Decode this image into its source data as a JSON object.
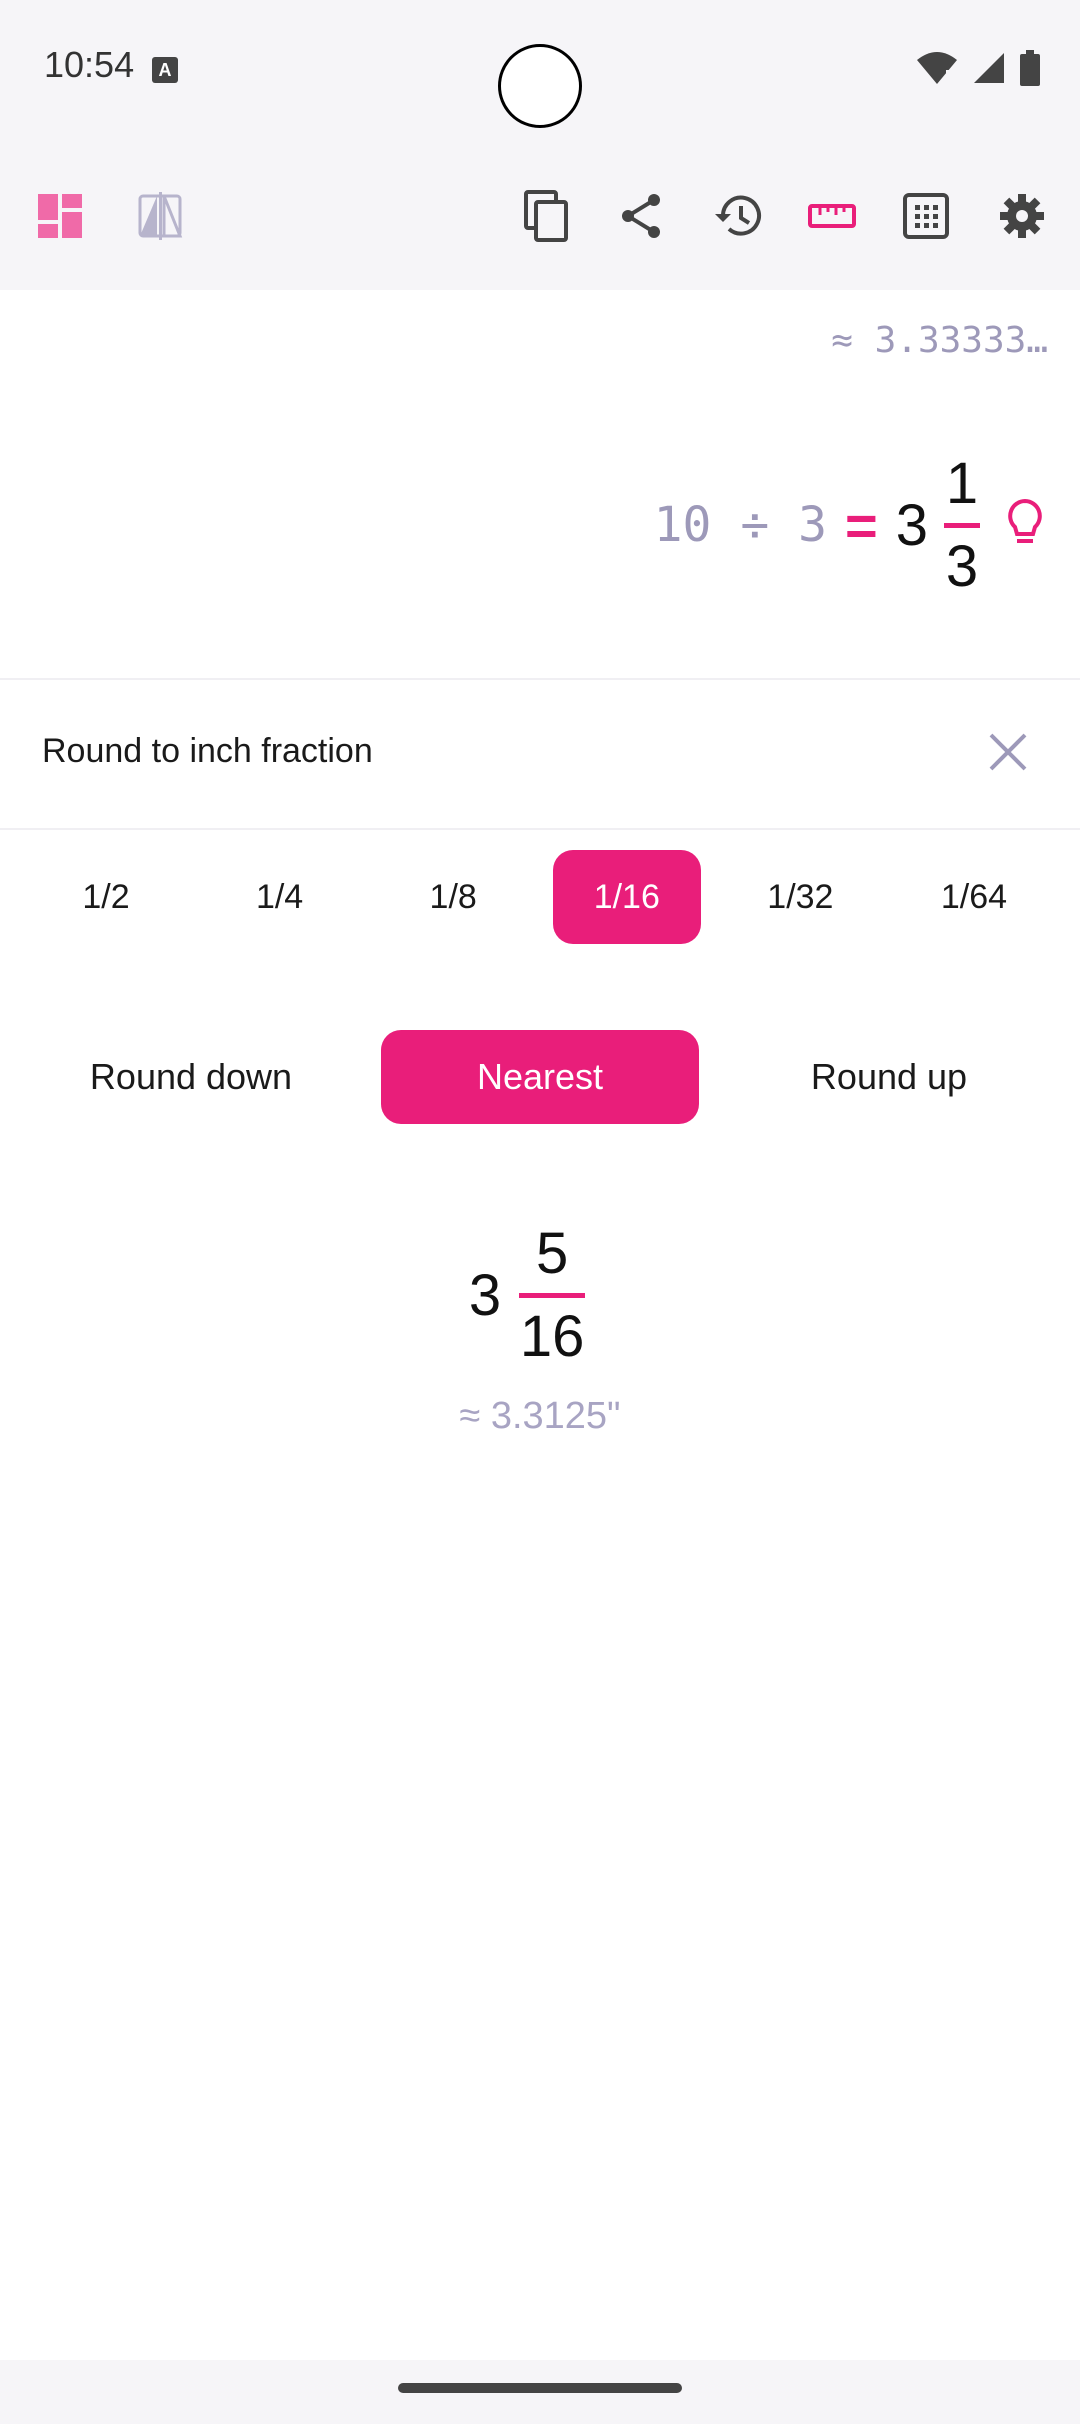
{
  "status_bar": {
    "time": "10:54",
    "notification_icon": "a-icon",
    "icons": [
      "wifi-icon",
      "signal-icon",
      "battery-icon"
    ]
  },
  "toolbar": {
    "left_icons": [
      "layout-icon",
      "flip-icon"
    ],
    "right_icons": [
      "copy-icon",
      "share-icon",
      "history-icon",
      "ruler-icon",
      "keypad-icon",
      "settings-icon"
    ]
  },
  "display": {
    "approx": "≈ 3.33333…",
    "expression": "10 ÷ 3",
    "equals": "=",
    "result_whole": "3",
    "result_numerator": "1",
    "result_denominator": "3"
  },
  "rounding": {
    "title": "Round to inch fraction",
    "fractions": [
      "1/2",
      "1/4",
      "1/8",
      "1/16",
      "1/32",
      "1/64"
    ],
    "selected_fraction": "1/16",
    "modes": [
      "Round down",
      "Nearest",
      "Round up"
    ],
    "selected_mode": "Nearest"
  },
  "result": {
    "whole": "3",
    "numerator": "5",
    "denominator": "16",
    "approx": "≈ 3.3125\""
  },
  "colors": {
    "accent": "#e91e7a",
    "muted": "#9d99b9",
    "toolbar_bg": "#f6f5f8"
  }
}
